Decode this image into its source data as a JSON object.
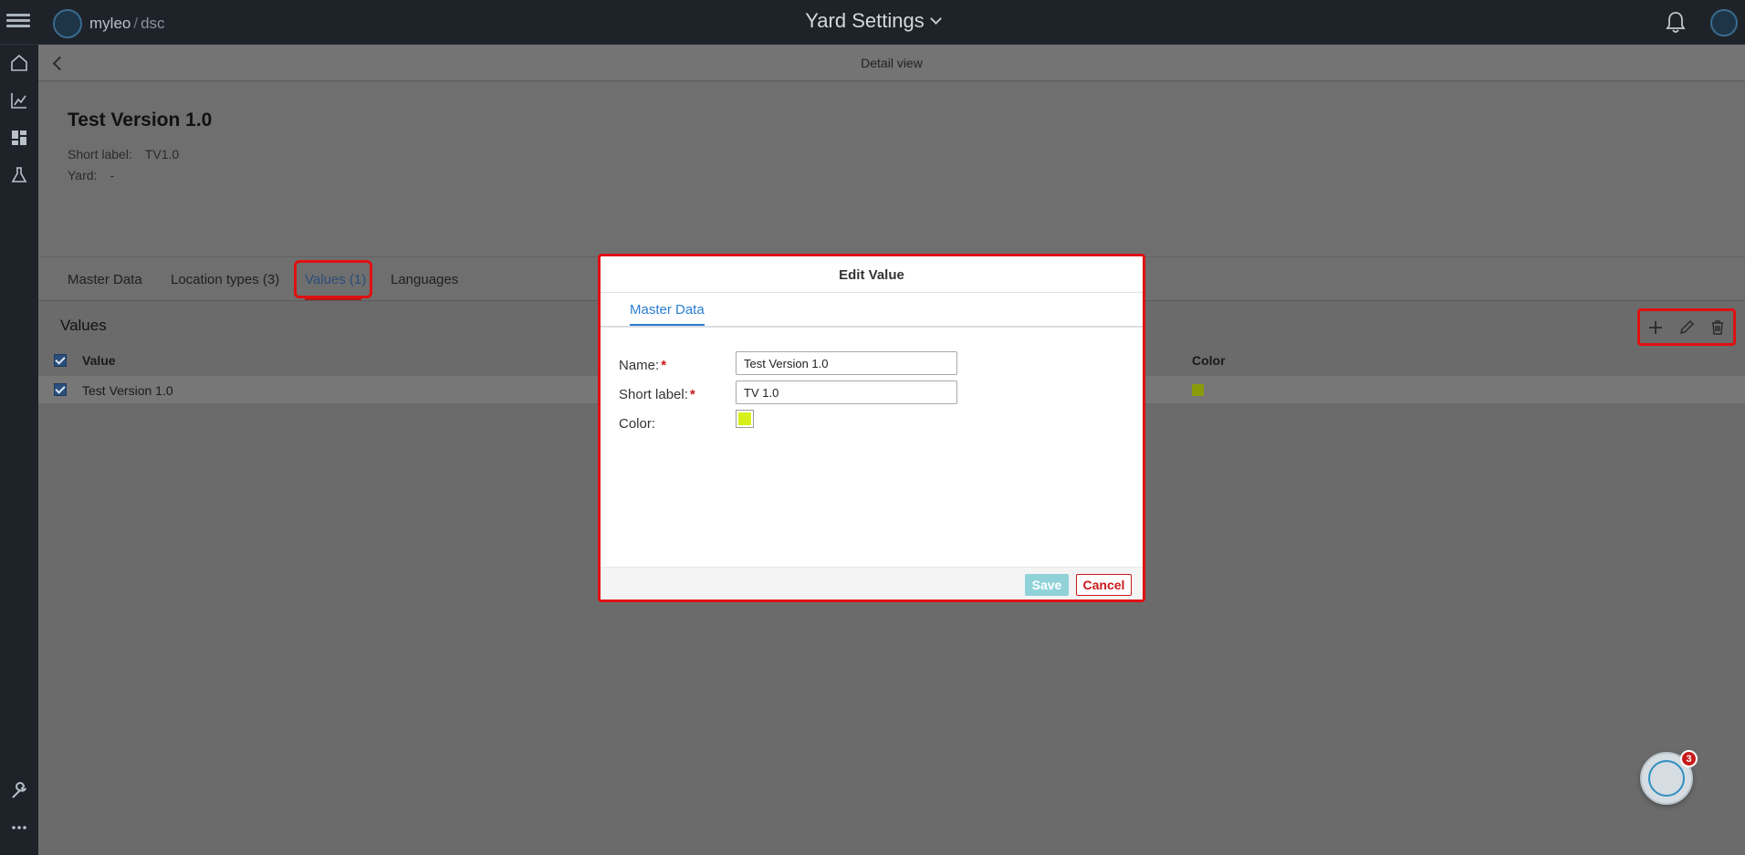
{
  "app": {
    "brand_name": "myleo",
    "brand_separator": "/",
    "brand_suffix": "dsc",
    "title": "Yard Settings",
    "icons": {
      "menu": "hamburger-icon",
      "notifications": "bell-icon",
      "user": "avatar-icon",
      "dropdown": "chevron-down-icon"
    }
  },
  "sidebar": {
    "items": [
      {
        "name": "home",
        "icon": "home-icon"
      },
      {
        "name": "reports",
        "icon": "chart-icon"
      },
      {
        "name": "dashboard",
        "icon": "dashboard-icon"
      },
      {
        "name": "lab",
        "icon": "flask-icon"
      },
      {
        "name": "settings",
        "icon": "wrench-icon"
      },
      {
        "name": "more",
        "icon": "more-dots-icon"
      }
    ]
  },
  "detail": {
    "header_title": "Detail view",
    "record_title": "Test Version 1.0",
    "meta": {
      "short_label_label": "Short label:",
      "short_label_value": "TV1.0",
      "yard_label": "Yard:",
      "yard_value": "-"
    },
    "tabs": [
      {
        "label": "Master Data",
        "active": false
      },
      {
        "label": "Location types (3)",
        "active": false
      },
      {
        "label": "Values (1)",
        "active": true
      },
      {
        "label": "Languages",
        "active": false
      }
    ]
  },
  "values_panel": {
    "title": "Values",
    "toolbar": {
      "add_icon": "plus-icon",
      "edit_icon": "pencil-icon",
      "delete_icon": "trash-icon"
    },
    "columns": [
      "Value",
      "Color"
    ],
    "rows": [
      {
        "value": "Test Version 1.0",
        "color": "#8a9a0a",
        "checked": true
      }
    ]
  },
  "modal": {
    "title": "Edit Value",
    "tab": "Master Data",
    "fields": {
      "name_label": "Name:",
      "name_value": "Test Version 1.0",
      "short_label_label": "Short label:",
      "short_label_value": "TV 1.0",
      "color_label": "Color:",
      "color_value": "#d8f01a",
      "required_mark": "*"
    },
    "save_label": "Save",
    "cancel_label": "Cancel"
  },
  "chat": {
    "badge_count": "3",
    "icon": "assistant-icon"
  },
  "colors": {
    "accent": "#2a7ed2",
    "danger": "#c81a1a",
    "highlight": "#e01010",
    "topbar": "#1e2329"
  }
}
